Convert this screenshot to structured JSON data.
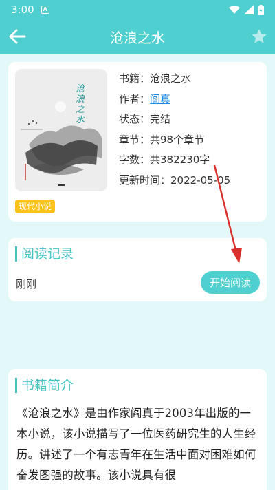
{
  "status_bar": {
    "time": "3:00",
    "notification_glyph": "A"
  },
  "app_bar": {
    "title": "沧浪之水"
  },
  "book": {
    "cover_title": "沧浪之水",
    "tag": "现代小说",
    "fields": [
      {
        "label": "书籍：",
        "value": "沧浪之水"
      },
      {
        "label": "作者：",
        "value": "阎真"
      },
      {
        "label": "状态：",
        "value": "完结"
      },
      {
        "label": "章节：",
        "value": "共98个章节"
      },
      {
        "label": "字数：",
        "value": "共382230字"
      },
      {
        "label": "更新时间：",
        "value": "2022-05-05"
      }
    ]
  },
  "reading": {
    "section_title": "阅读记录",
    "last_read": "刚刚",
    "start_label": "开始阅读"
  },
  "intro": {
    "section_title": "书籍简介",
    "text": "《沧浪之水》是由作家阎真于2003年出版的一本小说，该小说描写了一位医药研究生的人生经历。讲述了一个有志青年在生活中面对困难如何奋发图强的故事。该小说具有很"
  },
  "colors": {
    "accent": "#4fcfcf",
    "tag": "#ffc21a",
    "link": "#1e88e5",
    "annotation_arrow": "#d9302c"
  }
}
